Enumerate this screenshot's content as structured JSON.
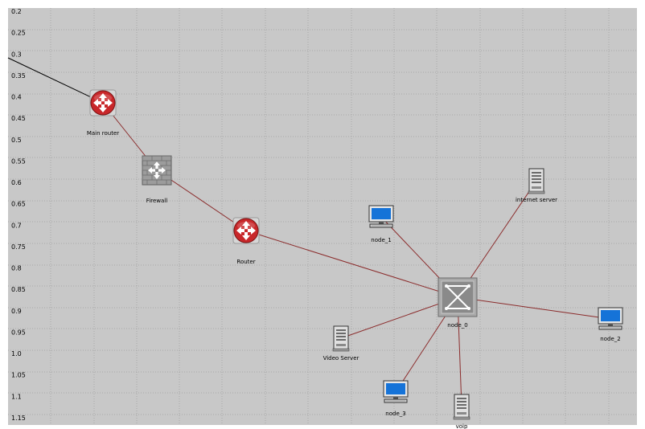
{
  "canvas": {
    "background": "#c8c8c8",
    "grid_color": "#a8a8a8",
    "y_ruler_ticks": [
      "0.2",
      "0.25",
      "0.3",
      "0.35",
      "0.4",
      "0.45",
      "0.5",
      "0.55",
      "0.6",
      "0.65",
      "0.7",
      "0.75",
      "0.8",
      "0.85",
      "0.9",
      "0.95",
      "1.0",
      "1.05",
      "1.1",
      "1.15"
    ]
  },
  "colors": {
    "router": "#c8272a",
    "link": "#8b2c2c",
    "external_link": "#000000",
    "pc_screen": "#1573d8"
  },
  "nodes": [
    {
      "id": "main_router",
      "label": "Main router",
      "icon": "router-icon"
    },
    {
      "id": "firewall",
      "label": "Firewall",
      "icon": "firewall-icon"
    },
    {
      "id": "router",
      "label": "Router",
      "icon": "router-icon"
    },
    {
      "id": "node_0",
      "label": "node_0",
      "icon": "switch-icon"
    },
    {
      "id": "node_1",
      "label": "node_1",
      "icon": "workstation-icon"
    },
    {
      "id": "node_2",
      "label": "node_2",
      "icon": "workstation-icon"
    },
    {
      "id": "node_3",
      "label": "node_3",
      "icon": "workstation-icon"
    },
    {
      "id": "internet_server",
      "label": "internet server",
      "icon": "server-icon"
    },
    {
      "id": "video_server",
      "label": "Video Server",
      "icon": "server-icon"
    },
    {
      "id": "voip",
      "label": "voip",
      "icon": "server-icon"
    }
  ],
  "links": [
    {
      "from": "external",
      "to": "main_router"
    },
    {
      "from": "main_router",
      "to": "firewall"
    },
    {
      "from": "firewall",
      "to": "router"
    },
    {
      "from": "router",
      "to": "node_0"
    },
    {
      "from": "node_0",
      "to": "node_1"
    },
    {
      "from": "node_0",
      "to": "internet_server"
    },
    {
      "from": "node_0",
      "to": "node_2"
    },
    {
      "from": "node_0",
      "to": "video_server"
    },
    {
      "from": "node_0",
      "to": "node_3"
    },
    {
      "from": "node_0",
      "to": "voip"
    }
  ]
}
